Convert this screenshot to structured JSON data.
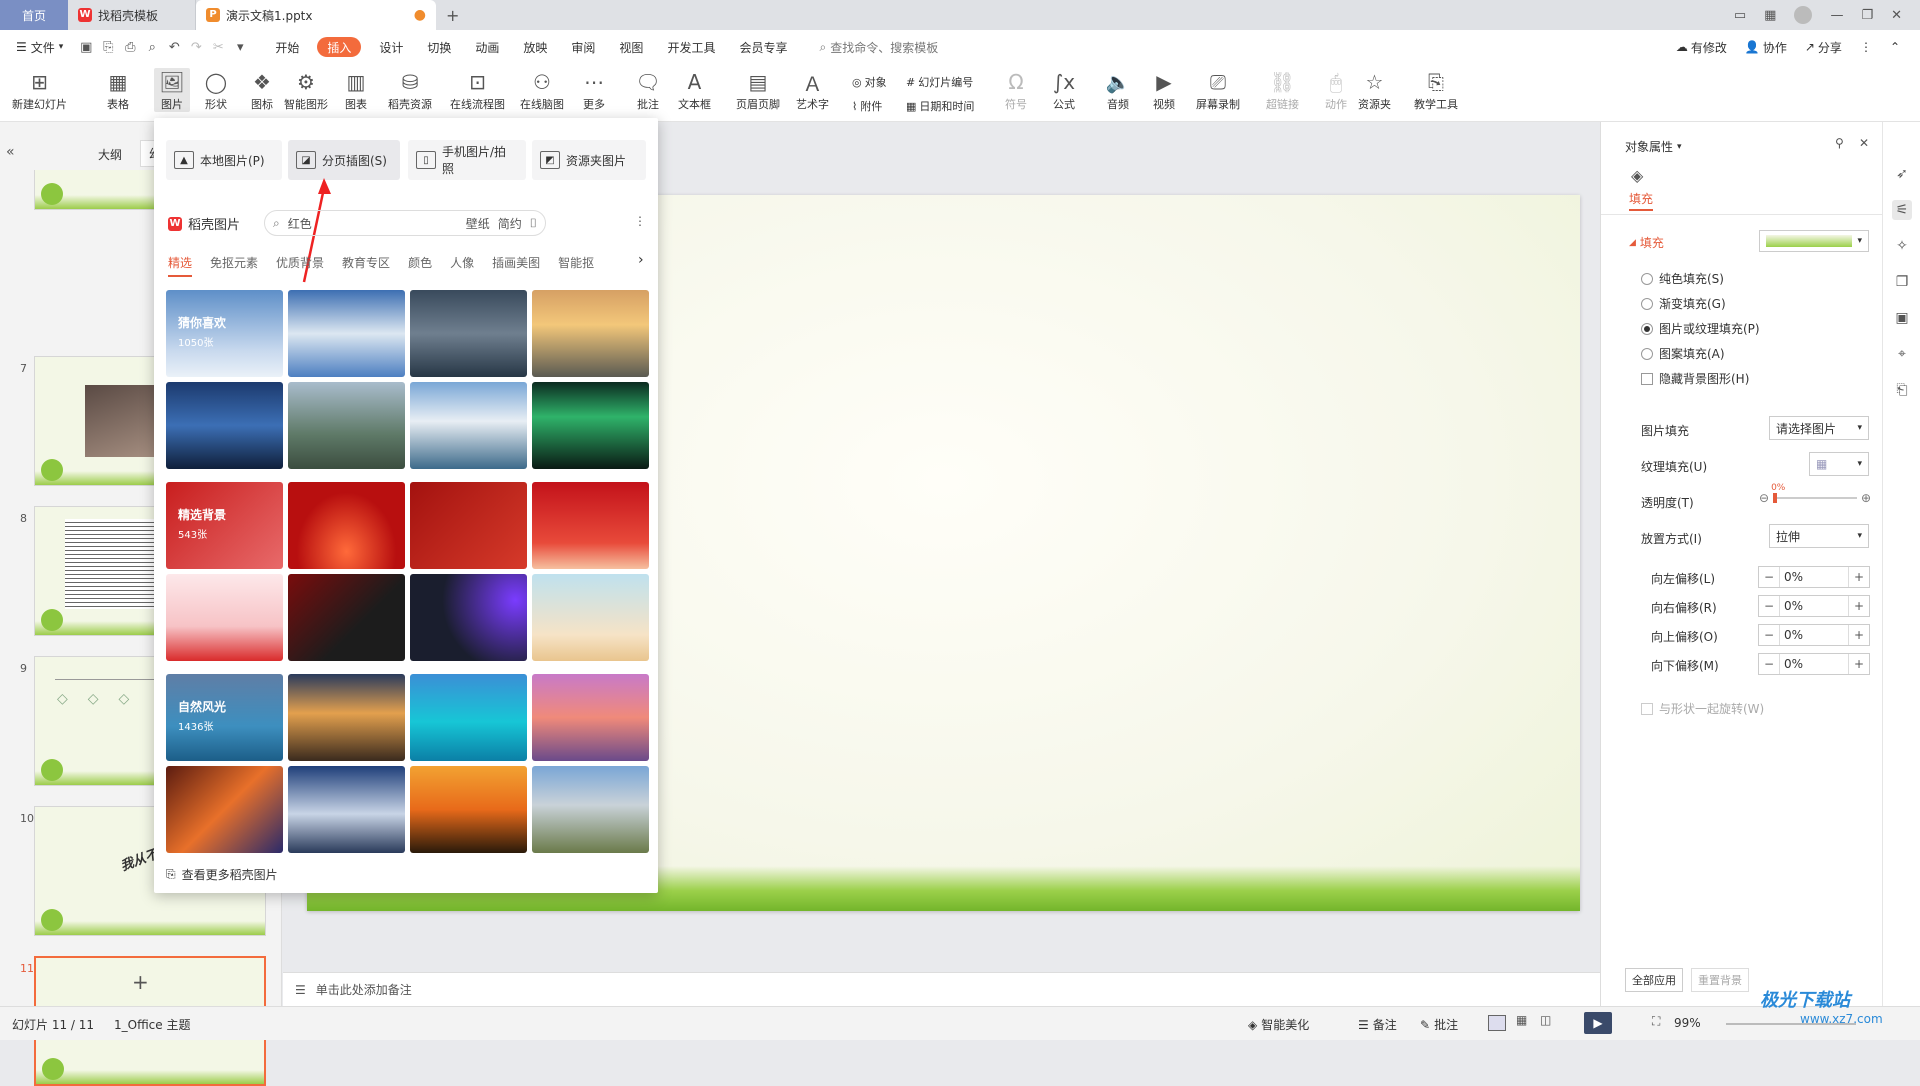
{
  "tabs": {
    "home": "首页",
    "t1": "找稻壳模板",
    "t2": "演示文稿1.pptx",
    "new_tab": "+"
  },
  "menu": {
    "file": "文件",
    "items": [
      "开始",
      "插入",
      "设计",
      "切换",
      "动画",
      "放映",
      "审阅",
      "视图",
      "开发工具",
      "会员专享"
    ],
    "active": "插入",
    "search": "查找命令、搜索模板",
    "right": [
      "有修改",
      "协作",
      "分享"
    ]
  },
  "ribbon": {
    "new_slide": "新建幻灯片",
    "table": "表格",
    "picture": "图片",
    "shape": "形状",
    "icon": "图标",
    "smart": "智能图形",
    "chart": "图表",
    "docer": "稻壳资源",
    "flowchart": "在线流程图",
    "mindmap": "在线脑图",
    "more": "更多",
    "comment": "批注",
    "textbox": "文本框",
    "header_footer": "页眉页脚",
    "wordart": "艺术字",
    "object": "对象",
    "slide_number": "幻灯片编号",
    "attachment": "附件",
    "datetime": "日期和时间",
    "symbol": "符号",
    "formula": "公式",
    "audio": "音频",
    "video": "视频",
    "screen_rec": "屏幕录制",
    "hyperlink": "超链接",
    "action": "动作",
    "resource": "资源夹",
    "teaching": "教学工具"
  },
  "left_panel": {
    "outline_tab": "大纲",
    "slide_tab": "幻",
    "slides": [
      {
        "num": "7"
      },
      {
        "num": "8"
      },
      {
        "num": "9"
      },
      {
        "num": "10",
        "text": "我从不写"
      },
      {
        "num": "11"
      }
    ],
    "add": "+"
  },
  "popup": {
    "buttons": [
      "本地图片(P)",
      "分页插图(S)",
      "手机图片/拍照",
      "资源夹图片"
    ],
    "brand": "稻壳图片",
    "search_value": "红色",
    "chips": [
      "壁纸",
      "简约"
    ],
    "categories": [
      "精选",
      "免抠元素",
      "优质背景",
      "教育专区",
      "颜色",
      "人像",
      "插画美图",
      "智能抠"
    ],
    "active_category": "精选",
    "groups": [
      {
        "label": "猜你喜欢",
        "count": "1050张"
      },
      {
        "label": "精选背景",
        "count": "543张"
      },
      {
        "label": "自然风光",
        "count": "1436张"
      }
    ],
    "more": "查看更多稻壳图片"
  },
  "right_pane": {
    "title": "对象属性",
    "tab": "填充",
    "section": "填充",
    "options": [
      "纯色填充(S)",
      "渐变填充(G)",
      "图片或纹理填充(P)",
      "图案填充(A)"
    ],
    "selected_option": "图片或纹理填充(P)",
    "hide_bg": "隐藏背景图形(H)",
    "picture_fill_label": "图片填充",
    "picture_fill_value": "请选择图片",
    "texture_label": "纹理填充(U)",
    "transparency_label": "透明度(T)",
    "transparency_value": "0%",
    "placement_label": "放置方式(I)",
    "placement_value": "拉伸",
    "offsets": [
      {
        "label": "向左偏移(L)",
        "value": "0%"
      },
      {
        "label": "向右偏移(R)",
        "value": "0%"
      },
      {
        "label": "向上偏移(O)",
        "value": "0%"
      },
      {
        "label": "向下偏移(M)",
        "value": "0%"
      }
    ],
    "rotate": "与形状一起旋转(W)",
    "apply_all": "全部应用",
    "reset_bg": "重置背景"
  },
  "notes": {
    "placeholder": "单击此处添加备注"
  },
  "status": {
    "slide": "幻灯片 11 / 11",
    "theme": "1_Office 主题",
    "beautify": "智能美化",
    "notes": "备注",
    "comment": "批注",
    "zoom": "99%"
  },
  "watermark": {
    "brand": "极光下载站",
    "url": "www.xz7.com"
  },
  "colors": {
    "accent": "#f36b3c",
    "active_tab_red": "#e55a3a",
    "home_tab": "#7a8fc4"
  }
}
